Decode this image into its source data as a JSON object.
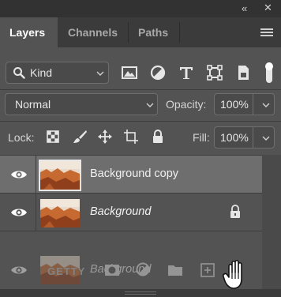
{
  "topbar": {
    "collapse_glyph": "«",
    "close_glyph": "✕"
  },
  "tabs": [
    {
      "label": "Layers",
      "active": true
    },
    {
      "label": "Channels",
      "active": false
    },
    {
      "label": "Paths",
      "active": false
    }
  ],
  "filter": {
    "kind_label": "Kind",
    "icons": [
      "image-filter-icon",
      "adjustment-filter-icon",
      "type-filter-icon",
      "shape-filter-icon",
      "smart-object-filter-icon"
    ]
  },
  "blend": {
    "mode": "Normal",
    "opacity_label": "Opacity:",
    "opacity_value": "100%"
  },
  "lock": {
    "label": "Lock:",
    "fill_label": "Fill:",
    "fill_value": "100%"
  },
  "layers": [
    {
      "name": "Background copy",
      "selected": true,
      "italic": false,
      "locked": false
    },
    {
      "name": "Background",
      "selected": false,
      "italic": true,
      "locked": true
    }
  ],
  "drag_ghost": {
    "name": "Background",
    "faded_text": "GETTY"
  },
  "colors": {
    "panel": "#535353",
    "dark": "#3b3b3b",
    "selected_row": "#6e6e6e",
    "text": "#e6e6e6"
  }
}
